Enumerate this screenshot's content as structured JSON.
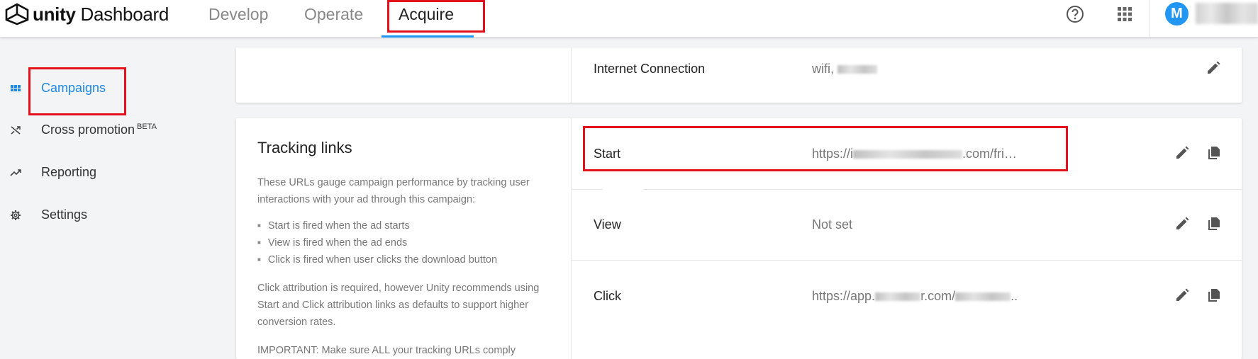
{
  "header": {
    "logo_text_bold": "unity",
    "logo_text_rest": " Dashboard",
    "tabs": [
      {
        "label": "Develop"
      },
      {
        "label": "Operate"
      },
      {
        "label": "Acquire"
      }
    ],
    "avatar_initial": "M",
    "icons": {
      "help": "help-circle-icon",
      "apps": "apps-grid-icon"
    }
  },
  "sidebar": {
    "items": [
      {
        "label": "Campaigns",
        "icon": "grid-icon"
      },
      {
        "label": "Cross promotion",
        "badge": "BETA",
        "icon": "shuffle-icon"
      },
      {
        "label": "Reporting",
        "icon": "trending-up-icon"
      },
      {
        "label": "Settings",
        "icon": "gear-icon"
      }
    ]
  },
  "targeting": {
    "internet_connection_label": "Internet Connection",
    "internet_connection_value": "wifi,"
  },
  "tracking": {
    "title": "Tracking links",
    "desc1": "These URLs gauge campaign performance by tracking user interactions with your ad through this campaign:",
    "bullets": [
      "Start is fired when the ad starts",
      "View is fired when the ad ends",
      "Click is fired when user clicks the download button"
    ],
    "desc2": "Click attribution is required, however Unity recommends using Start and Click attribution links as defaults to support higher conversion rates.",
    "desc3": "IMPORTANT: Make sure ALL your tracking URLs comply",
    "rows": [
      {
        "label": "Start",
        "value_prefix": "https://i",
        "value_suffix": ".com/fri…"
      },
      {
        "label": "View",
        "value": "Not set"
      },
      {
        "label": "Click",
        "value_prefix": "https://app.",
        "value_mid": "r.com/",
        "value_suffix": ".."
      }
    ]
  },
  "colors": {
    "accent": "#2196f3",
    "highlight": "#e3111b"
  }
}
